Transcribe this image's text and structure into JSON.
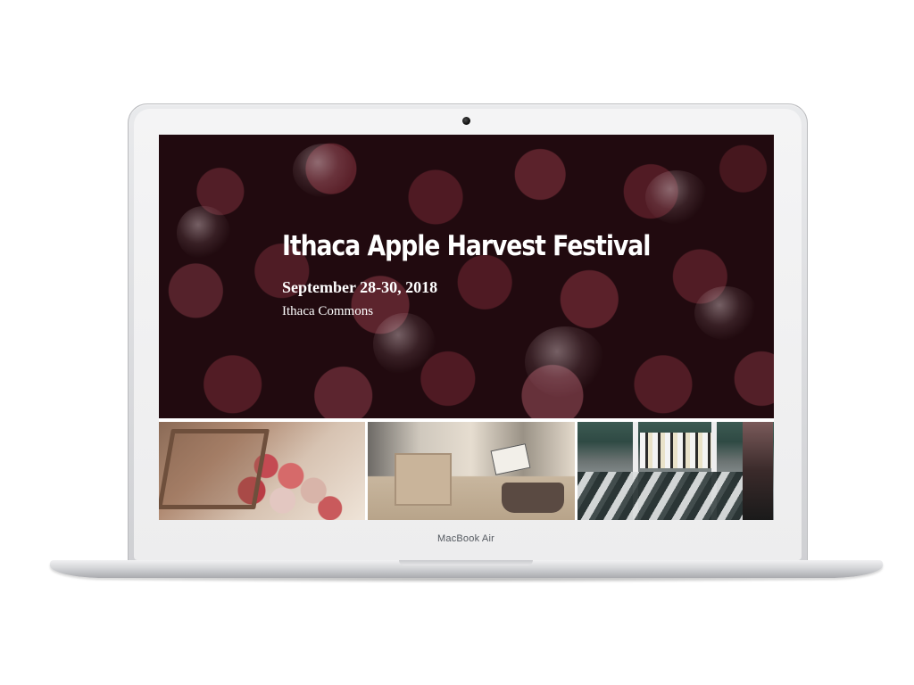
{
  "device": {
    "brand_label": "MacBook Air"
  },
  "hero": {
    "title": "Ithaca Apple Harvest Festival",
    "dates": "September 28-30, 2018",
    "location": "Ithaca Commons"
  },
  "gallery": {
    "photos": [
      "apple-crate-photo",
      "market-stall-photo",
      "vendor-table-photo"
    ]
  },
  "colors": {
    "hero_text": "#ffffff",
    "apple_red": "#6e2a35",
    "laptop_silver": "#d9dadd"
  }
}
